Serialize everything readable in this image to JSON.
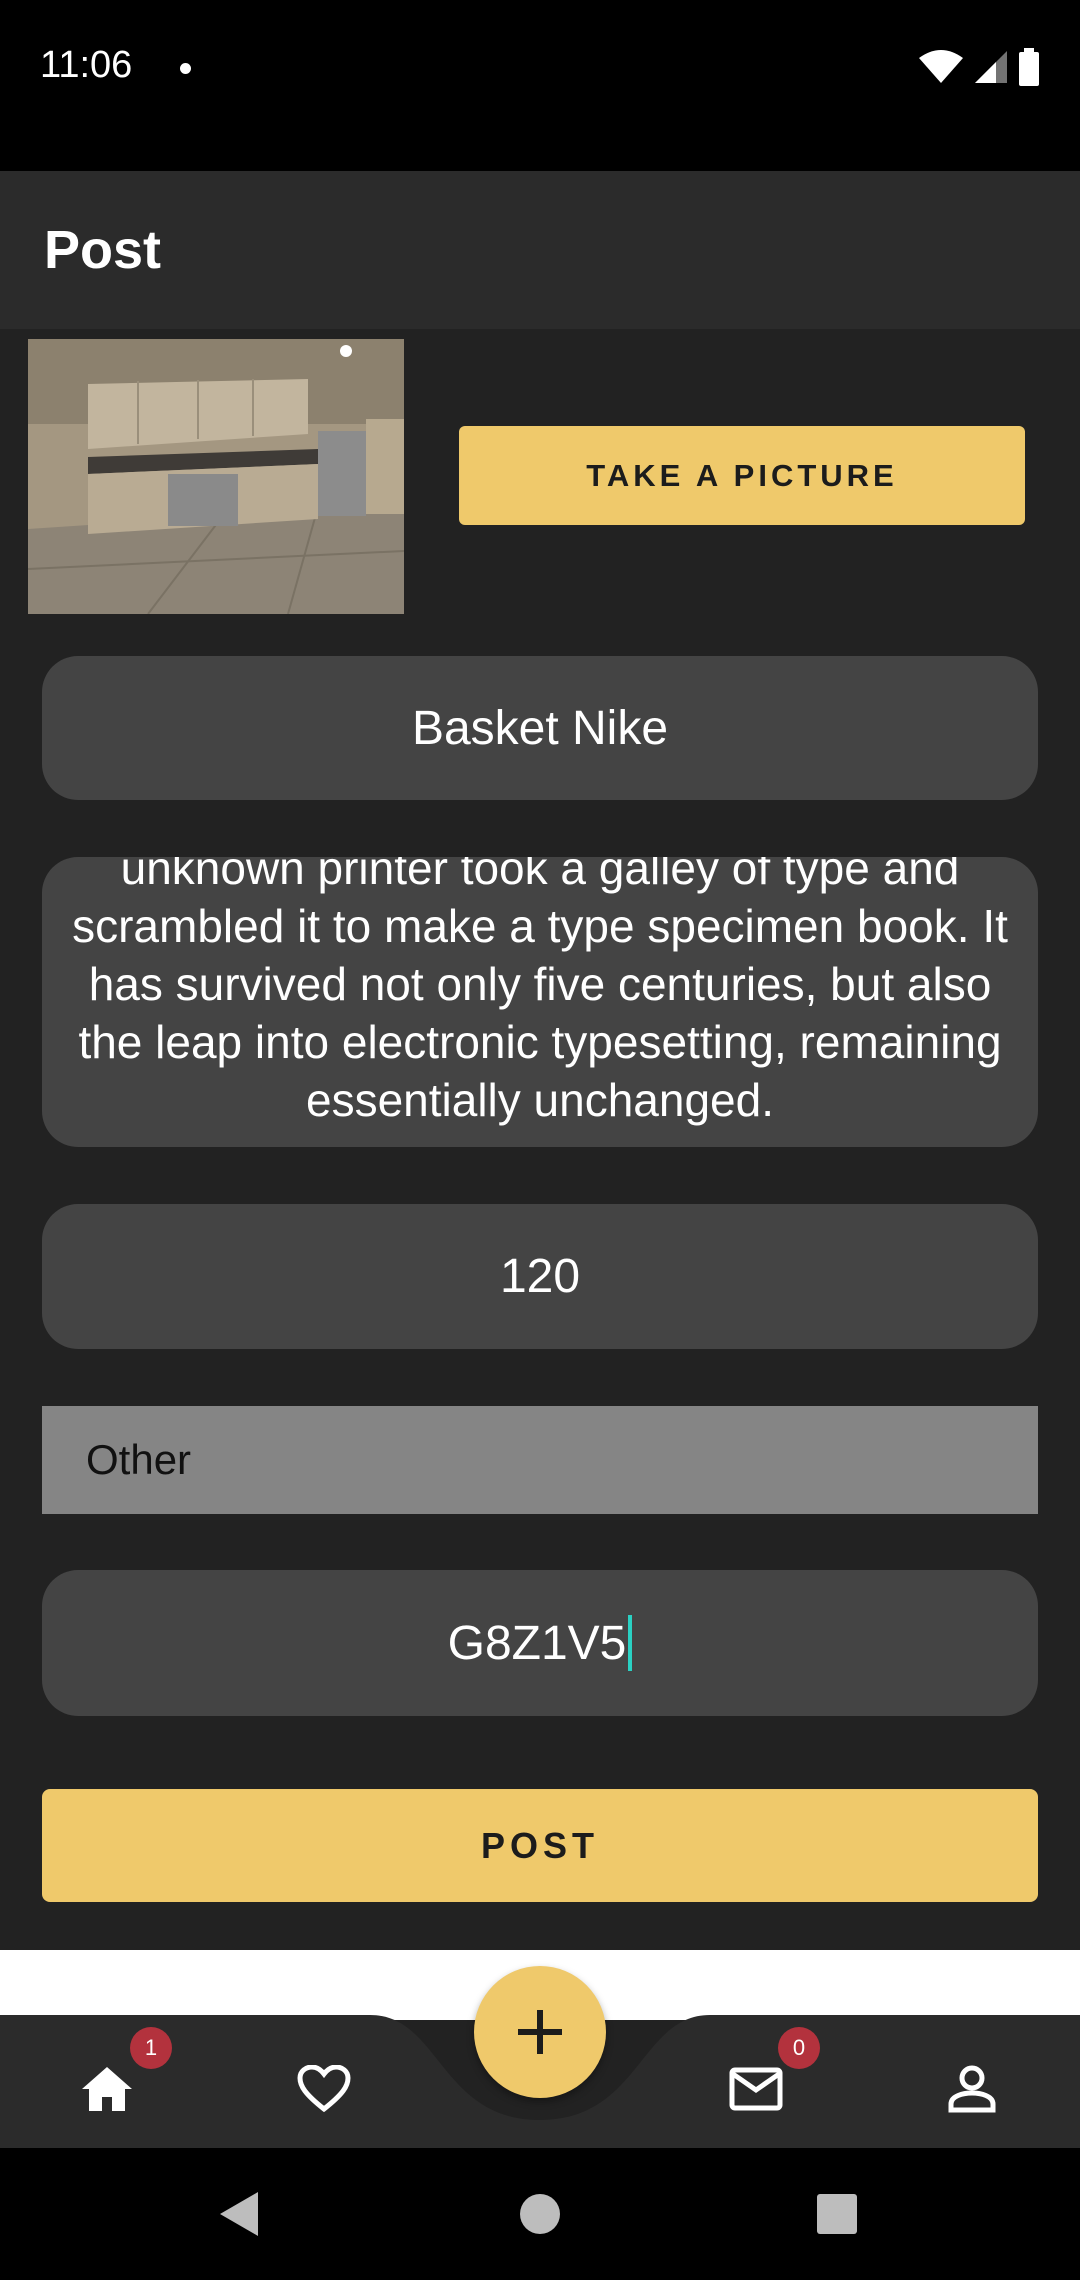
{
  "status": {
    "time": "11:06"
  },
  "app_bar": {
    "title": "Post"
  },
  "buttons": {
    "take_picture": "TAKE A PICTURE",
    "post": "POST"
  },
  "form": {
    "title_value": "Basket Nike",
    "description_value": "unknown printer took a galley of type and scrambled it to make a type specimen book. It has survived not only five centuries, but also the leap into electronic typesetting, remaining essentially unchanged.",
    "price_value": "120",
    "category_value": "Other",
    "code_value": "G8Z1V5"
  },
  "nav": {
    "items": [
      {
        "icon": "home-icon",
        "badge": "1"
      },
      {
        "icon": "heart-icon"
      },
      {
        "icon": "plus-icon"
      },
      {
        "icon": "mail-icon",
        "badge": "0"
      },
      {
        "icon": "person-icon"
      }
    ]
  },
  "colors": {
    "accent": "#efc96b",
    "background": "#222222",
    "field": "#444444",
    "badge": "#b3323d",
    "cursor": "#2ad1c3"
  }
}
